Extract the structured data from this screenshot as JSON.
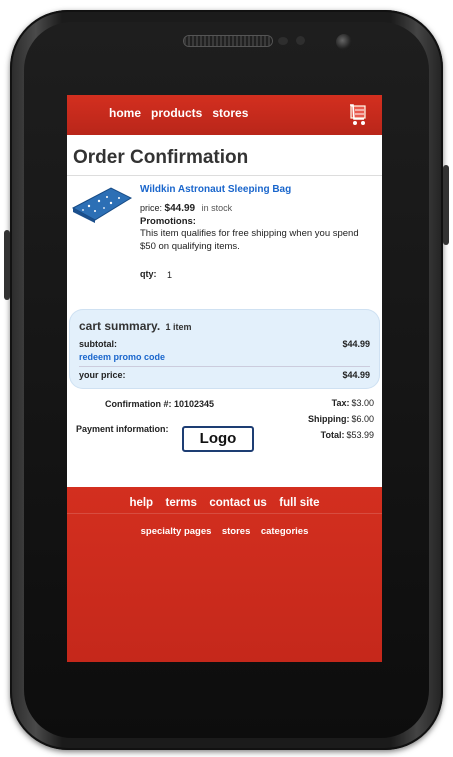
{
  "nav": {
    "items": [
      "home",
      "products",
      "stores"
    ],
    "cart_icon": "shopping-cart-icon"
  },
  "page": {
    "title": "Order Confirmation"
  },
  "product": {
    "image_icon": "sleeping-bag-image",
    "name": "Wildkin Astronaut Sleeping Bag",
    "price_label": "price:",
    "price": "$44.99",
    "stock": "in stock",
    "promotions_label": "Promotions:",
    "promotion_text": "This item qualifies for free shipping when you spend $50 on qualifying items.",
    "qty_label": "qty:",
    "qty": "1"
  },
  "summary": {
    "title": "cart summary.",
    "count": "1 item",
    "subtotal_label": "subtotal:",
    "subtotal": "$44.99",
    "promo_link": "redeem promo code",
    "your_price_label": "your price:",
    "your_price": "$44.99"
  },
  "order": {
    "confirmation_label": "Confirmation #:",
    "confirmation_number": "10102345",
    "payment_label": "Payment information:",
    "payment_logo": "Logo"
  },
  "totals": {
    "tax_label": "Tax:",
    "tax": "$3.00",
    "shipping_label": "Shipping:",
    "shipping": "$6.00",
    "total_label": "Total:",
    "total": "$53.99"
  },
  "footer": {
    "links": [
      "help",
      "terms",
      "contact us",
      "full site"
    ],
    "links2": [
      "specialty pages",
      "stores",
      "categories"
    ]
  },
  "colors": {
    "brand_red": "#d32f1f",
    "link_blue": "#1a66cc",
    "summary_bg": "#e3f0fb"
  }
}
